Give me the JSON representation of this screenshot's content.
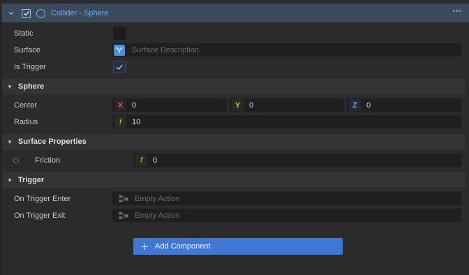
{
  "component": {
    "title": "Collider - Sphere",
    "enabled": true,
    "menu_glyph": "•••"
  },
  "properties": {
    "static_label": "Static",
    "static_checked": false,
    "surface_label": "Surface",
    "surface_placeholder": "Surface Description",
    "is_trigger_label": "Is Trigger",
    "is_trigger_checked": true
  },
  "sphere": {
    "title": "Sphere",
    "center_label": "Center",
    "center": {
      "x_axis": "X",
      "x": "0",
      "y_axis": "Y",
      "y": "0",
      "z_axis": "Z",
      "z": "0"
    },
    "radius_label": "Radius",
    "radius_axis": "f",
    "radius": "10"
  },
  "surface_properties": {
    "title": "Surface Properties",
    "friction_label": "Friction",
    "friction_axis": "f",
    "friction": "0"
  },
  "trigger": {
    "title": "Trigger",
    "enter_label": "On Trigger Enter",
    "enter_placeholder": "Empty Action",
    "exit_label": "On Trigger Exit",
    "exit_placeholder": "Empty Action"
  },
  "add_component": {
    "label": "Add Component"
  },
  "colors": {
    "accent": "#3f78d4",
    "header_bg": "#3c4a5e",
    "title_blue": "#6fa8e6",
    "x_axis": "#e25555",
    "y_axis": "#a6d04a",
    "z_axis": "#6ea8e0"
  }
}
